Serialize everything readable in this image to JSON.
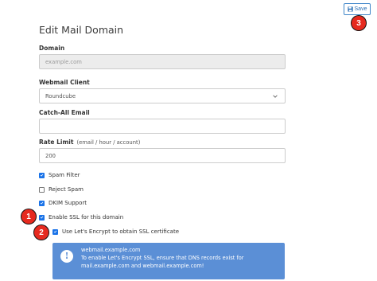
{
  "toolbar": {
    "save_label": "Save"
  },
  "badges": [
    "3",
    "1",
    "2"
  ],
  "page_title": "Edit Mail Domain",
  "domain": {
    "label": "Domain",
    "value": "example.com"
  },
  "webmail": {
    "label": "Webmail Client",
    "value": "Roundcube"
  },
  "catch_all": {
    "label": "Catch-All Email",
    "value": ""
  },
  "rate_limit": {
    "label": "Rate Limit",
    "sublabel": "(email / hour / account)",
    "value": "200"
  },
  "options": [
    {
      "label": "Spam Filter",
      "checked": true
    },
    {
      "label": "Reject Spam",
      "checked": false
    },
    {
      "label": "DKIM Support",
      "checked": true
    },
    {
      "label": "Enable SSL for this domain",
      "checked": true
    },
    {
      "label": "Use Let's Encrypt to obtain SSL certificate",
      "checked": true
    }
  ],
  "alert": {
    "line1": "webmail.example.com",
    "line2": "To enable Let's Encrypt SSL, ensure that DNS records exist for",
    "line3": "mail.example.com and webmail.example.com!"
  },
  "colors": {
    "accent": "#1a73e8",
    "badge": "#e62a1f",
    "alert_bg": "#5b8fd6"
  }
}
